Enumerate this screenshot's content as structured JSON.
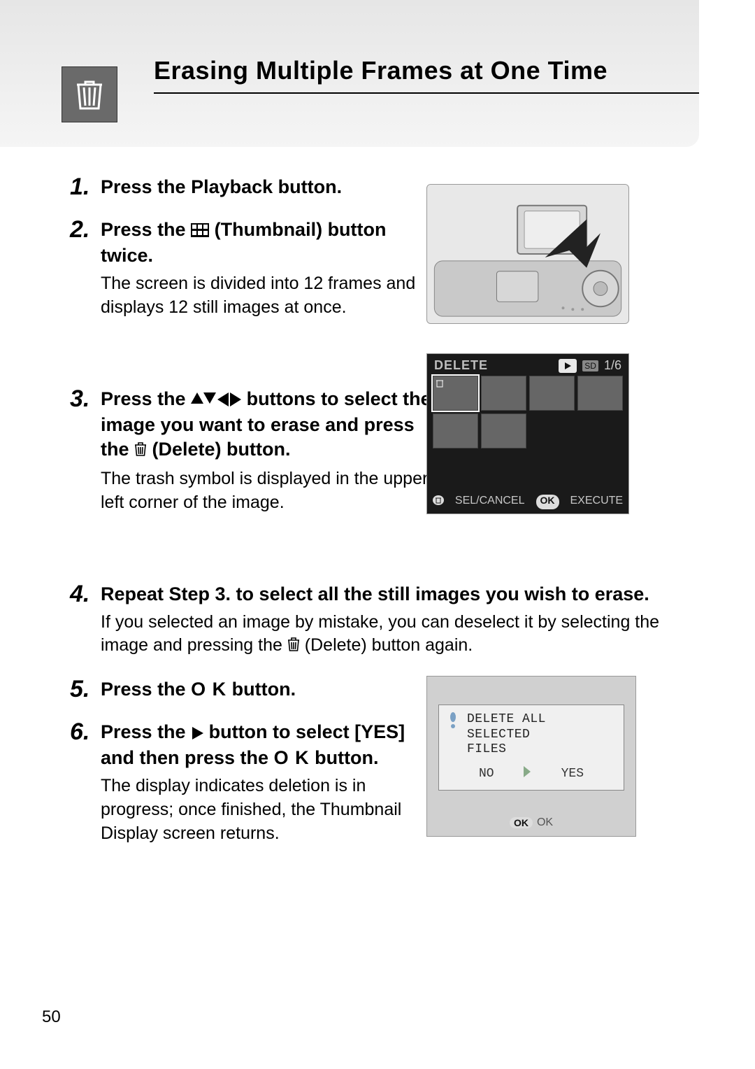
{
  "page_number": "50",
  "title": "Erasing Multiple Frames at One Time",
  "steps": {
    "s1": {
      "num": "1.",
      "instr": "Press the Playback button."
    },
    "s2": {
      "num": "2.",
      "instr_a": "Press the ",
      "instr_b": " (Thumbnail) button twice.",
      "desc": "The screen is divided into 12 frames and displays 12 still images at once."
    },
    "s3": {
      "num": "3.",
      "instr_a": "Press the ",
      "instr_b": " buttons to select the image you want to erase and press the ",
      "instr_c": " (Delete) button.",
      "desc": "The trash symbol is displayed in the upper left corner of the image."
    },
    "s4": {
      "num": "4.",
      "instr": "Repeat Step 3. to select all the still images you wish to erase.",
      "desc_a": "If you selected an image by mistake, you can deselect it by selecting the image and pressing the ",
      "desc_b": " (Delete) button again."
    },
    "s5": {
      "num": "5.",
      "instr_a": "Press the ",
      "ok": "O K",
      "instr_b": " button."
    },
    "s6": {
      "num": "6.",
      "instr_a": "Press the ",
      "instr_b": " button to select [YES] and then press the ",
      "ok": "O K",
      "instr_c": " button.",
      "desc": "The display indicates deletion is in progress; once finished, the Thumbnail Display screen returns."
    }
  },
  "screen2": {
    "label": "DELETE",
    "counter": "1/6",
    "sd": "SD",
    "bottom_left": "SEL/CANCEL",
    "bottom_right": "EXECUTE",
    "ok": "OK"
  },
  "screen3": {
    "line1": "DELETE ALL SELECTED",
    "line2": "FILES",
    "no": "NO",
    "yes": "YES",
    "ok_badge": "OK",
    "ok_text": "OK"
  }
}
